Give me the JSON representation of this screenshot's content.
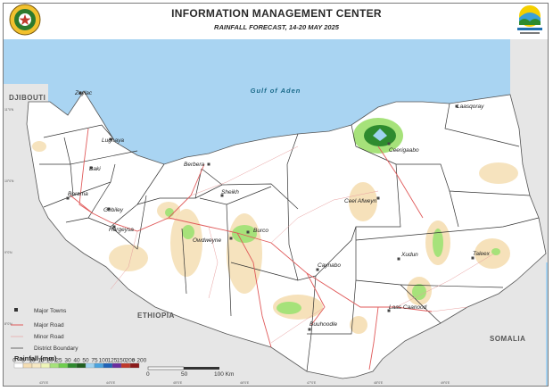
{
  "header": {
    "title": "INFORMATION MANAGEMENT CENTER",
    "subtitle": "RAINFALL FORECAST, 14-20 MAY 2025"
  },
  "map": {
    "sea_label": "Gulf of Aden",
    "countries": {
      "djibouti": "DJIBOUTI",
      "ethiopia": "ETHIOPIA",
      "somalia": "SOMALIA"
    },
    "towns": [
      {
        "name": "Zeylac"
      },
      {
        "name": "Lughaya"
      },
      {
        "name": "Baki"
      },
      {
        "name": "Borama"
      },
      {
        "name": "Gebiley"
      },
      {
        "name": "Hargeysa"
      },
      {
        "name": "Berbera"
      },
      {
        "name": "Sheikh"
      },
      {
        "name": "Owdweyne"
      },
      {
        "name": "Burco"
      },
      {
        "name": "Ceerigaabo"
      },
      {
        "name": "Laasqoray"
      },
      {
        "name": "Ceel Afweyn"
      },
      {
        "name": "Xudun"
      },
      {
        "name": "Taleex"
      },
      {
        "name": "Caynabo"
      },
      {
        "name": "Laas Caanood"
      },
      {
        "name": "Buuhoodle"
      }
    ]
  },
  "legend": {
    "major_towns": "Major Towns",
    "major_road": "Major Road",
    "minor_road": "Minor Road",
    "district_boundary": "District Boundary",
    "rainfall_title": "Rainfall (mm)",
    "rainfall_breaks": [
      "0",
      "5",
      "10",
      "15",
      "20",
      "25",
      "30",
      "40",
      "50",
      "75",
      "100",
      "125",
      "150",
      "200",
      "> 200"
    ],
    "rainfall_colors": [
      "#ffffff",
      "#f5deb3",
      "#f7e9c4",
      "#eef5b8",
      "#a6e27a",
      "#6fcf4e",
      "#2e8b2e",
      "#1f5f1f",
      "#9fd3f0",
      "#4aa3df",
      "#2063b8",
      "#6a2c9e",
      "#c0392b",
      "#8b1a1a"
    ],
    "scale": [
      "0",
      "50",
      "100 Km"
    ]
  },
  "graticule": {
    "bottom": [
      "43°0'E",
      "44°0'E",
      "45°0'E",
      "46°0'E",
      "47°0'E",
      "48°0'E",
      "49°0'E"
    ],
    "left": [
      "11°0'N",
      "10°0'N",
      "9°0'N",
      "8°0'N"
    ]
  }
}
